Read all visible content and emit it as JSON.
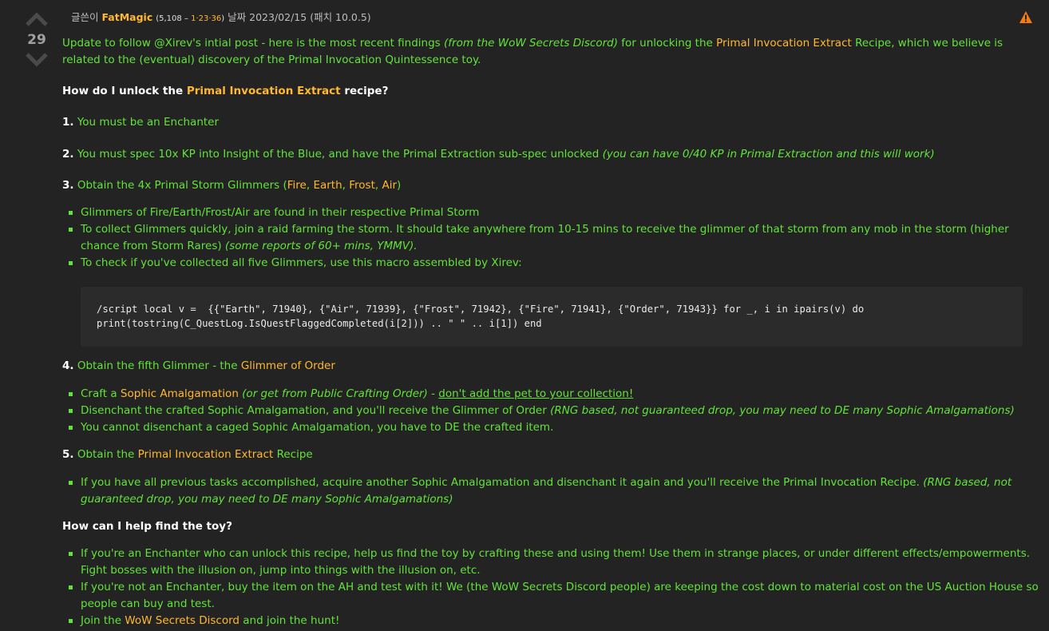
{
  "votes": {
    "count": "29"
  },
  "byline": {
    "prefix": "글쓴이",
    "author": "FatMagic",
    "stats_open": "(5,108 – ",
    "stats_time": "1·23·36",
    "stats_close": ")",
    "date": "날짜 2023/02/15",
    "patch": "(패치 10.0.5)"
  },
  "intro": {
    "t1": "Update to follow @Xirev's intial post - here is the most recent findings ",
    "t2": "(from the WoW Secrets Discord)",
    "t3": " for unlocking the ",
    "t4": "Primal Invocation Extract",
    "t5": " Recipe, which we believe is related to the (eventual) discovery of the Primal Invocation Quintessence toy."
  },
  "h1": {
    "a": "How do I unlock the ",
    "b": "Primal Invocation Extract",
    "c": " recipe?"
  },
  "step1": {
    "num": "1.",
    "text": " You must be an Enchanter"
  },
  "step2": {
    "num": "2.",
    "text": " You must spec 10x KP into Insight of the Blue, and have the Primal Extraction sub-spec unlocked ",
    "note": "(you can have 0/40 KP in Primal Extraction and this will work)"
  },
  "step3": {
    "num": "3.",
    "text": " Obtain the 4x Primal Storm Glimmers (",
    "fire": "Fire",
    "earth": "Earth",
    "frost": "Frost",
    "air": "Air",
    "sep": ", ",
    "close": ")",
    "b1": "Glimmers of Fire/Earth/Frost/Air are found in their respective Primal Storm",
    "b2": "To collect Glimmers quickly, join a raid farming the storm. It should take anywhere from 10-15 mins to receive the glimmer of that storm from any mob in the storm (higher chance from Storm Rares) ",
    "b2_note": "(some reports of 60+ mins, YMMV).",
    "b3": "To check if you've collected all five Glimmers, use this macro assembled by Xirev:",
    "code": "/script local v =  {{\"Earth\", 71940}, {\"Air\", 71939}, {\"Frost\", 71942}, {\"Fire\", 71941}, {\"Order\", 71943}} for _, i in ipairs(v) do\nprint(tostring(C_QuestLog.IsQuestFlaggedCompleted(i[2])) .. \" \" .. i[1]) end"
  },
  "step4": {
    "num": "4.",
    "text": " Obtain the fifth Glimmer - the ",
    "link": "Glimmer of Order",
    "b1_a": "Craft a ",
    "b1_link": "Sophic Amalgamation",
    "b1_note": " (or get from Public Crafting Order)",
    "b1_sep": " - ",
    "b1_u": "don't add the pet to your collection!",
    "b2": "Disenchant the crafted Sophic Amalgamation, and you'll receive the Glimmer of Order ",
    "b2_note": "(RNG based, not guaranteed drop, you may need to DE many Sophic Amalgamations)",
    "b3": "You cannot disenchant a caged Sophic Amalgamation, you have to DE the crafted item."
  },
  "step5": {
    "num": "5.",
    "text": " Obtain the ",
    "link": "Primal Invocation Extract",
    "tail": " Recipe",
    "b1": "If you have all previous tasks accomplished, acquire another Sophic Amalgamation and disenchant it again and you'll receive the Primal Invocation Recipe. ",
    "b1_note": "(RNG based, not guaranteed drop, you may need to DE many Sophic Amalgamations)"
  },
  "h2": {
    "text": "How can I help find the toy?"
  },
  "help": {
    "b1": "If you're an Enchanter who can unlock this recipe, help us find the toy by crafting these and using them! Use them in strange places, or under different effects/empowerments. Fight bosses with the illusion on, jump into things with the illusion on, etc.",
    "b2": "If you're not an Enchanter, buy the item on the AH and test with it! We (the WoW Secrets Discord people) are keeping the cost down to material cost on the US Auction House so people can buy and test.",
    "b3_a": "Join the ",
    "b3_link": "WoW Secrets Discord",
    "b3_c": " and join the hunt!"
  },
  "colors": {
    "text_green": "#62e33a",
    "link_orange": "#ffb830",
    "background": "#232323",
    "code_bg": "#2b2b2b",
    "warning": "#f47a17"
  },
  "icons": {
    "upvote": "chevron-up-icon",
    "downvote": "chevron-down-icon",
    "report": "warning-triangle-icon"
  }
}
